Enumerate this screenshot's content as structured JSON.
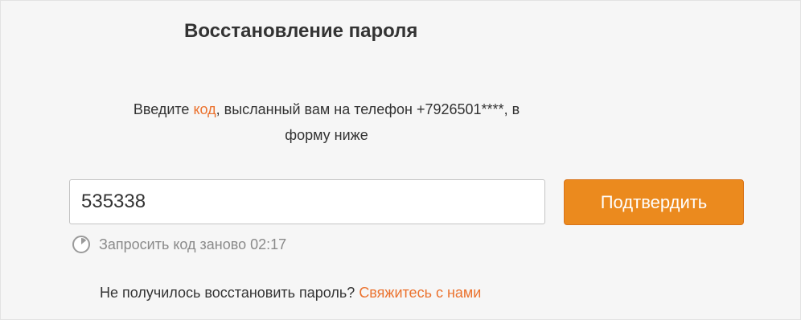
{
  "title": "Восстановление пароля",
  "instructions": {
    "before_link": "Введите ",
    "link": "код",
    "after_link": ", высланный вам на телефон +7926501****, в",
    "line2": "форму ниже"
  },
  "code_input": {
    "value": "535338",
    "placeholder": ""
  },
  "confirm_button": "Подтвердить",
  "resend": {
    "label": "Запросить код заново",
    "timer": "02:17",
    "icon": "timer-icon"
  },
  "help": {
    "question": "Не получилось восстановить пароль?",
    "link": "Свяжитесь с нами"
  },
  "colors": {
    "accent": "#eb722e",
    "button": "#eb8a1e",
    "muted": "#8a8a8a",
    "text": "#333333"
  }
}
